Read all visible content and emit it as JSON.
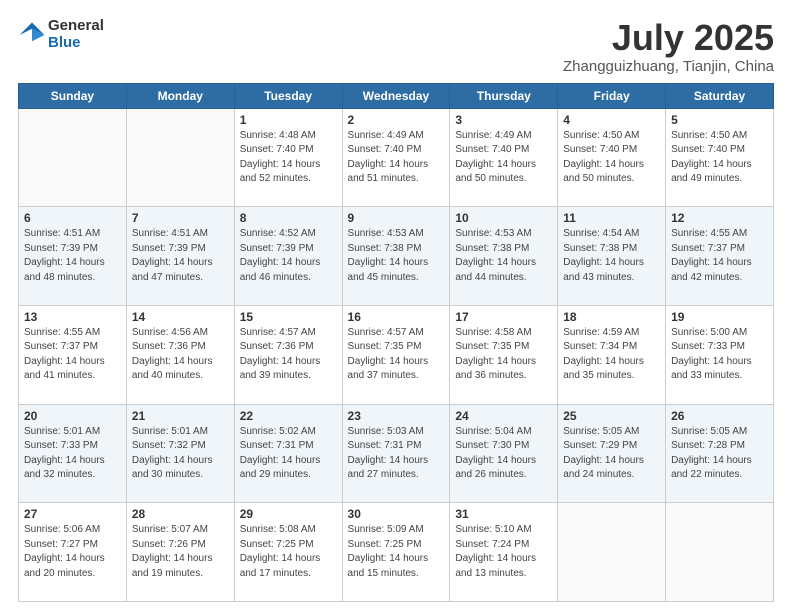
{
  "header": {
    "logo": {
      "general": "General",
      "blue": "Blue"
    },
    "title": "July 2025",
    "location": "Zhangguizhuang, Tianjin, China"
  },
  "days_of_week": [
    "Sunday",
    "Monday",
    "Tuesday",
    "Wednesday",
    "Thursday",
    "Friday",
    "Saturday"
  ],
  "weeks": [
    {
      "alt": false,
      "days": [
        {
          "num": "",
          "info": ""
        },
        {
          "num": "",
          "info": ""
        },
        {
          "num": "1",
          "info": "Sunrise: 4:48 AM\nSunset: 7:40 PM\nDaylight: 14 hours\nand 52 minutes."
        },
        {
          "num": "2",
          "info": "Sunrise: 4:49 AM\nSunset: 7:40 PM\nDaylight: 14 hours\nand 51 minutes."
        },
        {
          "num": "3",
          "info": "Sunrise: 4:49 AM\nSunset: 7:40 PM\nDaylight: 14 hours\nand 50 minutes."
        },
        {
          "num": "4",
          "info": "Sunrise: 4:50 AM\nSunset: 7:40 PM\nDaylight: 14 hours\nand 50 minutes."
        },
        {
          "num": "5",
          "info": "Sunrise: 4:50 AM\nSunset: 7:40 PM\nDaylight: 14 hours\nand 49 minutes."
        }
      ]
    },
    {
      "alt": true,
      "days": [
        {
          "num": "6",
          "info": "Sunrise: 4:51 AM\nSunset: 7:39 PM\nDaylight: 14 hours\nand 48 minutes."
        },
        {
          "num": "7",
          "info": "Sunrise: 4:51 AM\nSunset: 7:39 PM\nDaylight: 14 hours\nand 47 minutes."
        },
        {
          "num": "8",
          "info": "Sunrise: 4:52 AM\nSunset: 7:39 PM\nDaylight: 14 hours\nand 46 minutes."
        },
        {
          "num": "9",
          "info": "Sunrise: 4:53 AM\nSunset: 7:38 PM\nDaylight: 14 hours\nand 45 minutes."
        },
        {
          "num": "10",
          "info": "Sunrise: 4:53 AM\nSunset: 7:38 PM\nDaylight: 14 hours\nand 44 minutes."
        },
        {
          "num": "11",
          "info": "Sunrise: 4:54 AM\nSunset: 7:38 PM\nDaylight: 14 hours\nand 43 minutes."
        },
        {
          "num": "12",
          "info": "Sunrise: 4:55 AM\nSunset: 7:37 PM\nDaylight: 14 hours\nand 42 minutes."
        }
      ]
    },
    {
      "alt": false,
      "days": [
        {
          "num": "13",
          "info": "Sunrise: 4:55 AM\nSunset: 7:37 PM\nDaylight: 14 hours\nand 41 minutes."
        },
        {
          "num": "14",
          "info": "Sunrise: 4:56 AM\nSunset: 7:36 PM\nDaylight: 14 hours\nand 40 minutes."
        },
        {
          "num": "15",
          "info": "Sunrise: 4:57 AM\nSunset: 7:36 PM\nDaylight: 14 hours\nand 39 minutes."
        },
        {
          "num": "16",
          "info": "Sunrise: 4:57 AM\nSunset: 7:35 PM\nDaylight: 14 hours\nand 37 minutes."
        },
        {
          "num": "17",
          "info": "Sunrise: 4:58 AM\nSunset: 7:35 PM\nDaylight: 14 hours\nand 36 minutes."
        },
        {
          "num": "18",
          "info": "Sunrise: 4:59 AM\nSunset: 7:34 PM\nDaylight: 14 hours\nand 35 minutes."
        },
        {
          "num": "19",
          "info": "Sunrise: 5:00 AM\nSunset: 7:33 PM\nDaylight: 14 hours\nand 33 minutes."
        }
      ]
    },
    {
      "alt": true,
      "days": [
        {
          "num": "20",
          "info": "Sunrise: 5:01 AM\nSunset: 7:33 PM\nDaylight: 14 hours\nand 32 minutes."
        },
        {
          "num": "21",
          "info": "Sunrise: 5:01 AM\nSunset: 7:32 PM\nDaylight: 14 hours\nand 30 minutes."
        },
        {
          "num": "22",
          "info": "Sunrise: 5:02 AM\nSunset: 7:31 PM\nDaylight: 14 hours\nand 29 minutes."
        },
        {
          "num": "23",
          "info": "Sunrise: 5:03 AM\nSunset: 7:31 PM\nDaylight: 14 hours\nand 27 minutes."
        },
        {
          "num": "24",
          "info": "Sunrise: 5:04 AM\nSunset: 7:30 PM\nDaylight: 14 hours\nand 26 minutes."
        },
        {
          "num": "25",
          "info": "Sunrise: 5:05 AM\nSunset: 7:29 PM\nDaylight: 14 hours\nand 24 minutes."
        },
        {
          "num": "26",
          "info": "Sunrise: 5:05 AM\nSunset: 7:28 PM\nDaylight: 14 hours\nand 22 minutes."
        }
      ]
    },
    {
      "alt": false,
      "days": [
        {
          "num": "27",
          "info": "Sunrise: 5:06 AM\nSunset: 7:27 PM\nDaylight: 14 hours\nand 20 minutes."
        },
        {
          "num": "28",
          "info": "Sunrise: 5:07 AM\nSunset: 7:26 PM\nDaylight: 14 hours\nand 19 minutes."
        },
        {
          "num": "29",
          "info": "Sunrise: 5:08 AM\nSunset: 7:25 PM\nDaylight: 14 hours\nand 17 minutes."
        },
        {
          "num": "30",
          "info": "Sunrise: 5:09 AM\nSunset: 7:25 PM\nDaylight: 14 hours\nand 15 minutes."
        },
        {
          "num": "31",
          "info": "Sunrise: 5:10 AM\nSunset: 7:24 PM\nDaylight: 14 hours\nand 13 minutes."
        },
        {
          "num": "",
          "info": ""
        },
        {
          "num": "",
          "info": ""
        }
      ]
    }
  ]
}
